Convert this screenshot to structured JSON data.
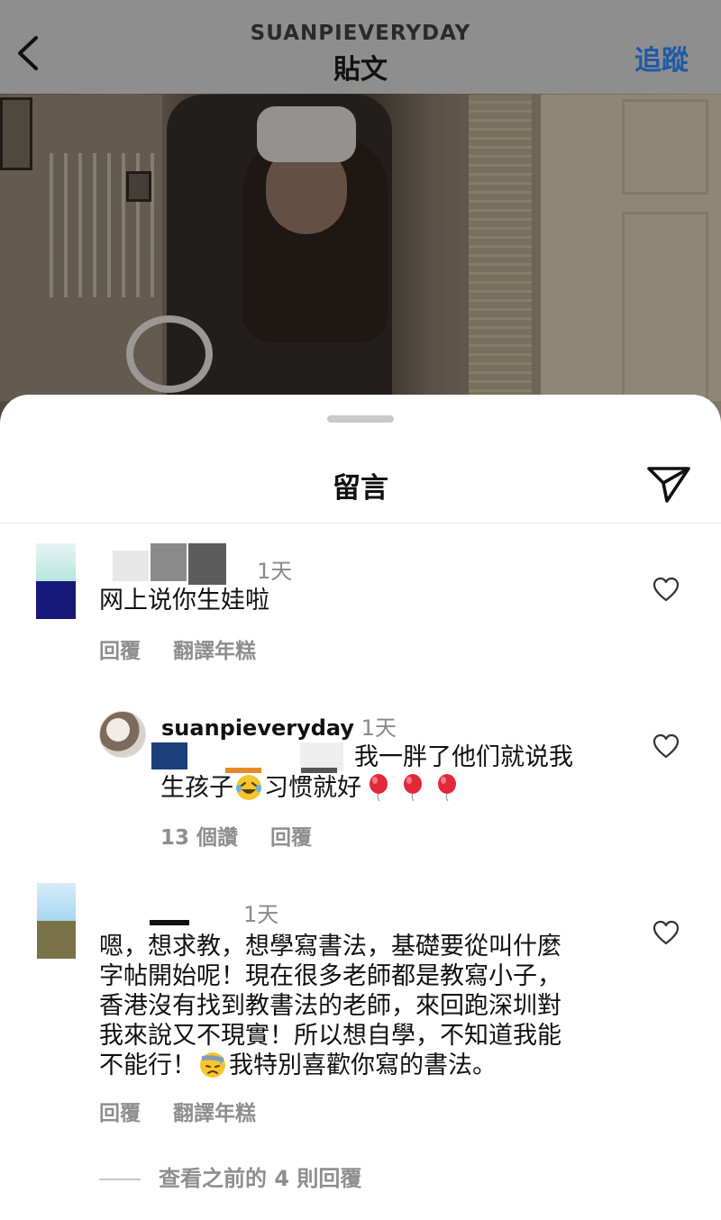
{
  "header": {
    "username": "SUANPIEVERYDAY",
    "title": "貼文",
    "follow_label": "追蹤"
  },
  "sheet": {
    "title": "留言"
  },
  "comments": [
    {
      "time": "1天",
      "text": "网上说你生娃啦",
      "reply_label": "回覆",
      "translate_label": "翻譯年糕"
    },
    {
      "username": "suanpieveryday",
      "time": "1天",
      "text_line1": "我一胖了他们就说我",
      "text_line2_a": "生孩子",
      "text_line2_b": "习惯就好",
      "likes_label": "13 個讚",
      "reply_label": "回覆"
    },
    {
      "time": "1天",
      "lines": [
        "嗯，想求教，想學寫書法，基礎要從叫什麼",
        "字帖開始呢！現在很多老師都是教寫小子，",
        "香港沒有找到教書法的老師，來回跑深圳對",
        "我來說又不現實！所以想自學，不知道我能"
      ],
      "last_line_a": "不能行！",
      "last_line_b": "我特別喜歡你寫的書法。",
      "reply_label": "回覆",
      "translate_label": "翻譯年糕"
    }
  ],
  "view_previous_replies": "查看之前的 4 則回覆",
  "icons": {
    "back": "chevron-left-icon",
    "share": "paper-plane-icon",
    "like": "heart-outline-icon"
  },
  "colors": {
    "follow": "#1f5aa6",
    "secondary_text": "#8e8e8e"
  }
}
